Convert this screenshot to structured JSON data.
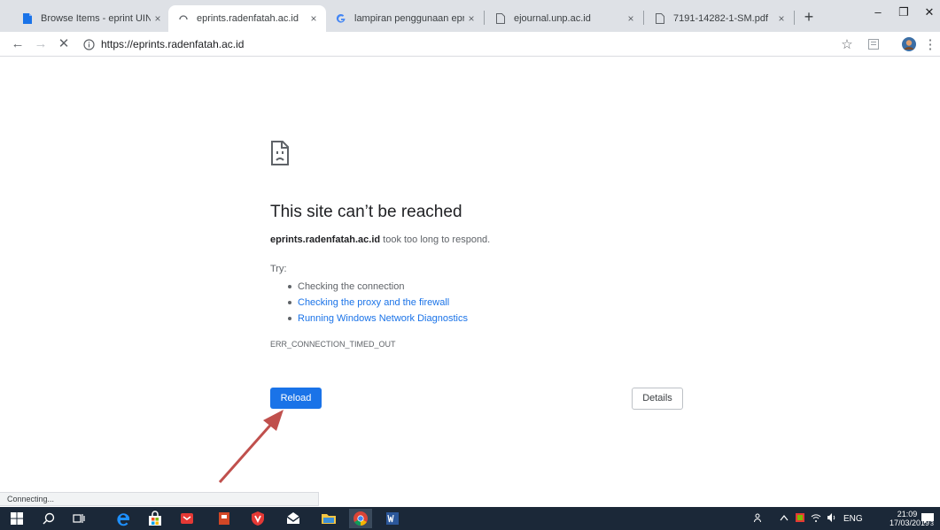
{
  "tabs": [
    {
      "title": "Browse Items - eprint UIN Rad",
      "favicon": "page-icon",
      "active": false
    },
    {
      "title": "eprints.radenfatah.ac.id",
      "favicon": "loading-spinner-icon",
      "active": true
    },
    {
      "title": "lampiran penggunaan eprints",
      "favicon": "google-icon",
      "active": false
    },
    {
      "title": "ejournal.unp.ac.id",
      "favicon": "page-icon",
      "active": false
    },
    {
      "title": "7191-14282-1-SM.pdf",
      "favicon": "page-icon",
      "active": false
    }
  ],
  "tab_close": "×",
  "new_tab": "+",
  "window": {
    "minimize": "–",
    "maximize": "❐",
    "close": "✕"
  },
  "toolbar": {
    "back": "←",
    "forward": "→",
    "stop": "✕",
    "url": "https://eprints.radenfatah.ac.id",
    "star": "☆",
    "menu": "⋮"
  },
  "error": {
    "title": "This site can’t be reached",
    "host": "eprints.radenfatah.ac.id",
    "message": " took too long to respond.",
    "try_label": "Try:",
    "suggestions": [
      "Checking the connection",
      "Checking the proxy and the firewall",
      "Running Windows Network Diagnostics"
    ],
    "code": "ERR_CONNECTION_TIMED_OUT",
    "reload_label": "Reload",
    "details_label": "Details"
  },
  "status_text": "Connecting...",
  "taskbar": {
    "apps": [
      "windows-start-icon",
      "search-icon",
      "task-view-icon",
      "edge-icon",
      "store-icon",
      "mail-icon",
      "powerpoint-icon",
      "antivirus-icon",
      "envelope-icon",
      "file-explorer-icon",
      "chrome-icon",
      "word-icon"
    ],
    "language": "ENG",
    "time": "21:09",
    "date": "17/03/2019",
    "notifications": "3"
  },
  "colors": {
    "accent": "#1a73e8",
    "annotation_arrow": "#c0504d",
    "taskbar": "#1b2838"
  }
}
